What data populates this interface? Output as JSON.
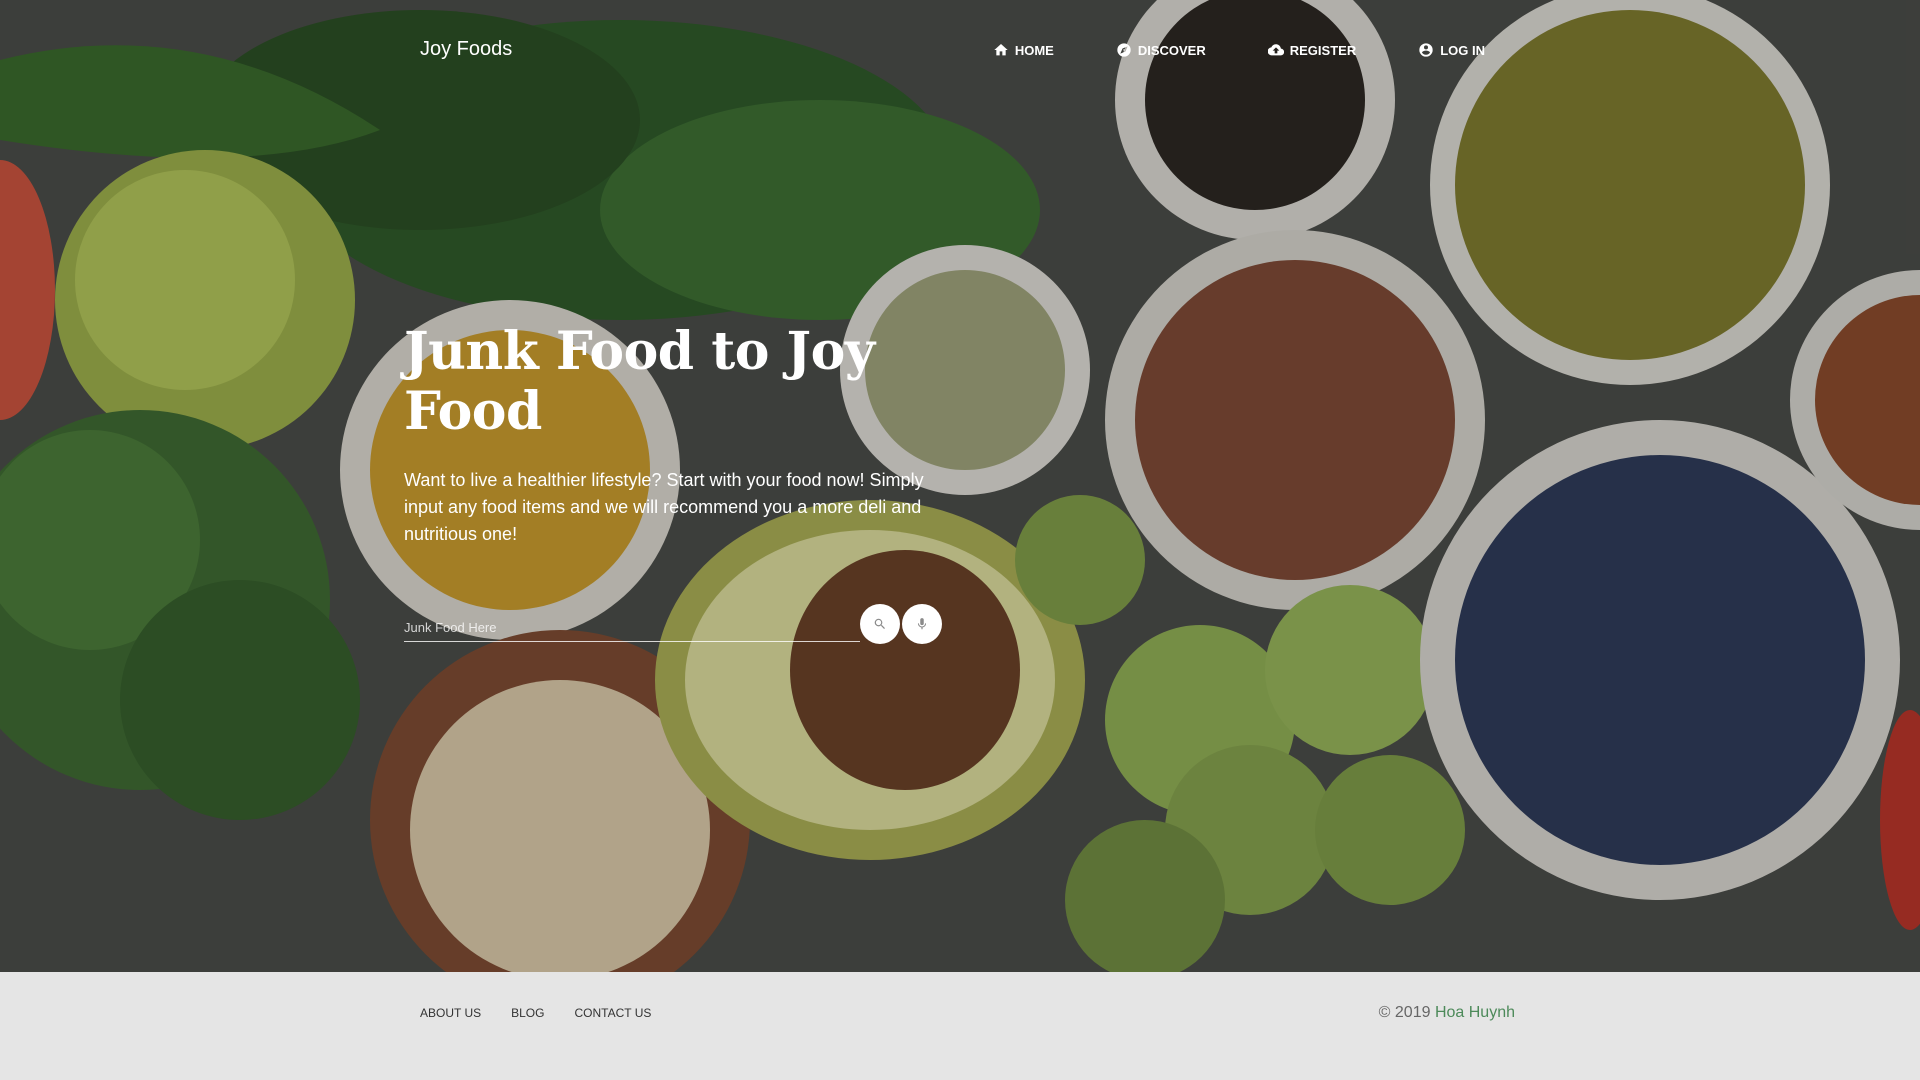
{
  "nav": {
    "brand": "Joy Foods",
    "items": [
      {
        "label": "HOME",
        "icon": "home-icon"
      },
      {
        "label": "DISCOVER",
        "icon": "compass-icon"
      },
      {
        "label": "REGISTER",
        "icon": "cloud-upload-icon"
      },
      {
        "label": "LOG IN",
        "icon": "account-circle-icon"
      }
    ]
  },
  "hero": {
    "title": "Junk Food to Joy Food",
    "description": "Want to live a healthier lifestyle? Start with your food now! Simply input any food items and we will recommend you a more deli and nutritious one!",
    "background": "bowls-of-healthy-foods-photo"
  },
  "search": {
    "placeholder": "Junk Food Here",
    "value": "",
    "search_icon": "search-icon",
    "mic_icon": "mic-icon"
  },
  "footer": {
    "links": [
      "ABOUT US",
      "BLOG",
      "CONTACT US"
    ],
    "copyright_prefix": "© 2019",
    "author": "Hoa Huynh",
    "author_color": "#4d8a5a"
  },
  "colors": {
    "footer_bg": "#e5e5e5",
    "text_light": "#ffffff"
  }
}
